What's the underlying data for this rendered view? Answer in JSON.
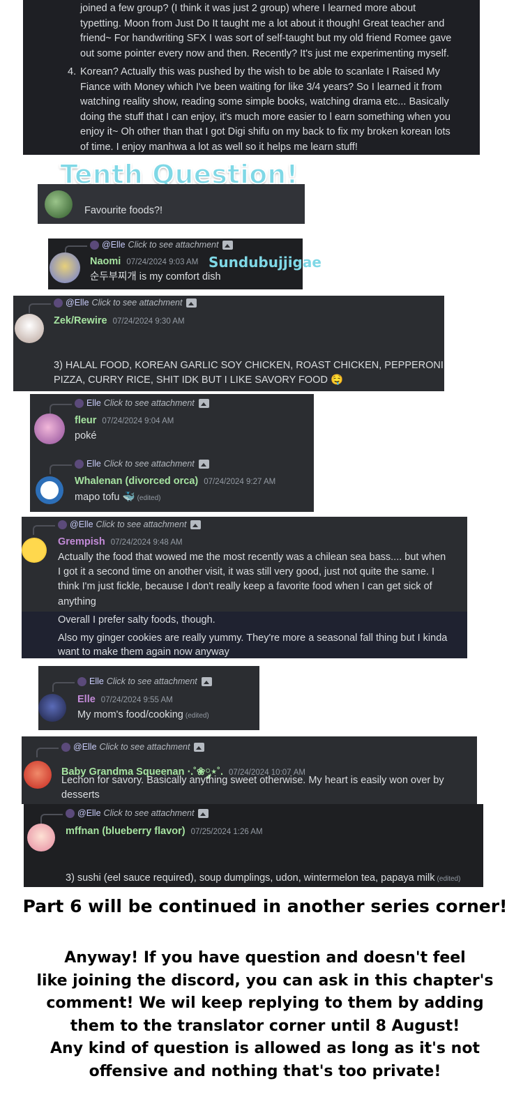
{
  "top_answers": [
    {
      "number": "",
      "lines": [
        "joined a few group? (I think it was just 2 group) where I learned more about",
        "typetting. Moon from Just Do It taught me a lot about it though! Great teacher and",
        "friend~ For handwriting SFX I was sort of self-taught but my old friend Romee gave",
        "out some pointer every now and then. Recently? It's just me experimenting myself."
      ]
    },
    {
      "number": "4.",
      "lines": [
        "Korean? Actually this was pushed by the wish to be able to scanlate I Raised My",
        "Fiance with Money which I've been waiting for like 3/4 years? So I learned it from",
        "watching reality show, reading some simple books, watching drama etc... Basically",
        "doing the stuff that I can enjoy, it's much more easier to l earn something when you",
        "enjoy it~ Oh other than that I got Digi shifu on my back to fix my broken korean lots",
        "of time. I enjoy manhwa a lot as well so it helps me learn stuff!"
      ]
    }
  ],
  "question": {
    "heading": "Tenth Question!",
    "text": "Favourite foods?!"
  },
  "reply_label": "Click to see attachment",
  "mention_at": "@Elle",
  "mention_plain": "Elle",
  "messages": {
    "naomi": {
      "name": "Naomi",
      "time": "07/24/2024 9:03 AM",
      "text": "순두부찌개 is my comfort dish",
      "note": "Sundubujjigae"
    },
    "zek": {
      "name": "Zek/Rewire",
      "time": "07/24/2024 9:30 AM",
      "line1": "3) HALAL FOOD, KOREAN GARLIC SOY CHICKEN, ROAST CHICKEN, PEPPERONI",
      "line2": "PIZZA, CURRY RICE, SHIT IDK BUT I LIKE SAVORY FOOD 🤤"
    },
    "fleur": {
      "name": "fleur",
      "time": "07/24/2024 9:04 AM",
      "text": "poké"
    },
    "whalenan": {
      "name": "Whalenan (divorced orca)",
      "time": "07/24/2024 9:27 AM",
      "text": "mapo tofu 🐳",
      "edited": "(edited)"
    },
    "grempish": {
      "name": "Grempish",
      "time": "07/24/2024 9:48 AM",
      "lines": [
        "Actually the food that wowed me the most recently was a chilean sea bass.... but when",
        "I got it a second time on another visit, it was still very good, just not quite the same. I",
        "think I'm just fickle, because I don't really keep a favorite food when I can get sick of",
        "anything"
      ],
      "followup1": "Overall I prefer salty foods, though.",
      "followup2a": "Also my ginger cookies are really yummy. They're more a seasonal fall thing but I kinda",
      "followup2b": "want to make them again now anyway"
    },
    "elle": {
      "name": "Elle",
      "time": "07/24/2024 9:55 AM",
      "text": "My mom's food/cooking",
      "edited": "(edited)"
    },
    "baby": {
      "name": "Baby Grandma Squeenan ⋅.˚❀༘⋆˚.",
      "time": "07/24/2024 10:07 AM",
      "line1": "Lechon for savory. Basically anything sweet otherwise. My heart is easily won over by",
      "line2": "desserts"
    },
    "mffnan": {
      "name": "mffnan (blueberry flavor)",
      "time": "07/25/2024 1:26 AM",
      "text": "3) sushi (eel sauce required), soup dumplings, udon, wintermelon tea, papaya milk",
      "edited": "(edited)"
    }
  },
  "footer": {
    "continued": "Part 6 will be continued in another series corner!",
    "lines": [
      "Anyway! If you have question and doesn't feel",
      "like joining the discord, you can ask in this chapter's",
      "comment! We wil keep replying to them by adding",
      "them to the translator corner until 8 August!",
      "Any kind of question is allowed as long as it's not",
      "offensive and nothing that's too private!"
    ]
  },
  "colors": {
    "panel": "#2b2d31",
    "username_green": "#a6e3a1",
    "username_purple": "#c38bd8",
    "heading_cyan": "#7fd8e6"
  }
}
